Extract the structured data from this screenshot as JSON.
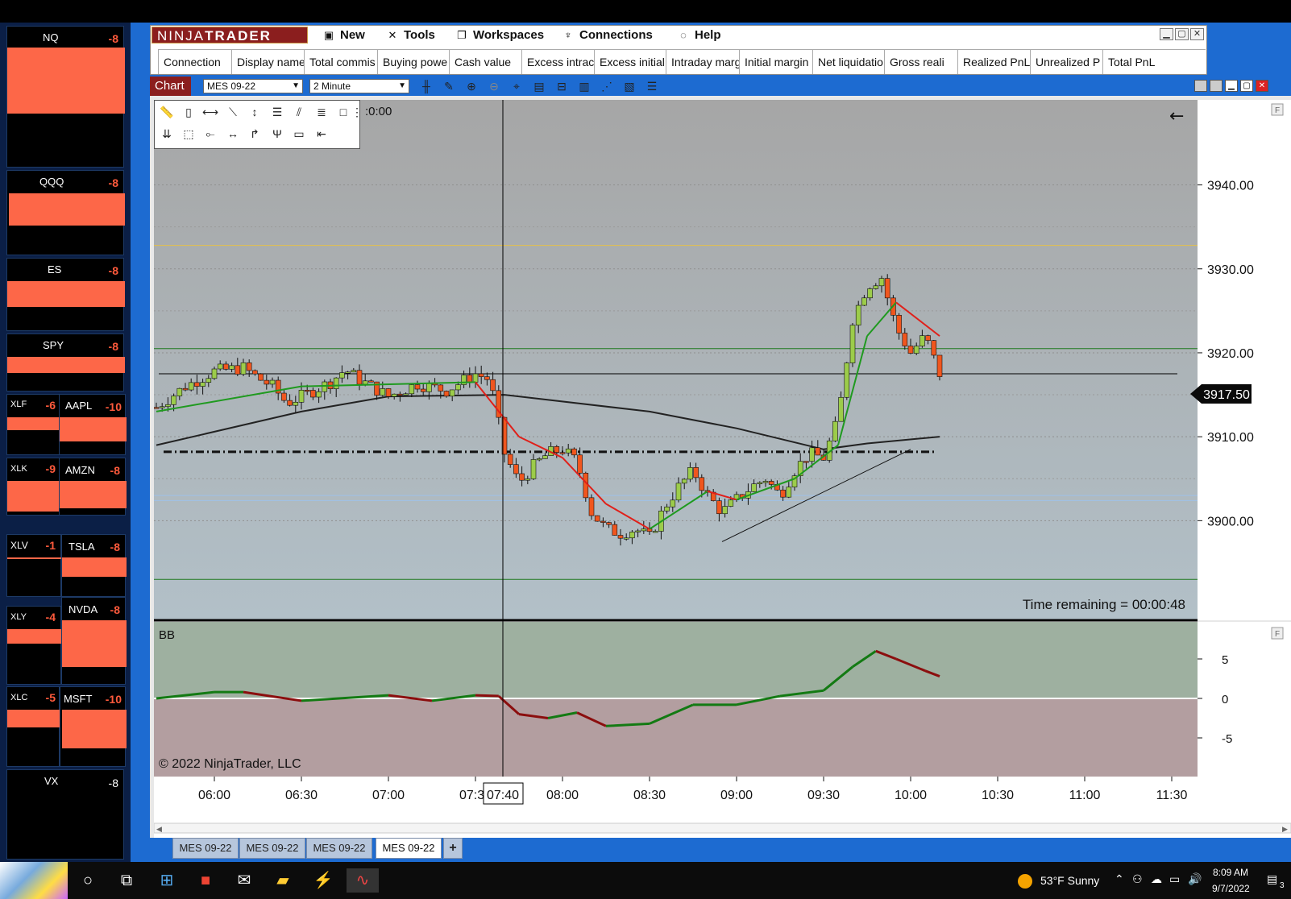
{
  "sidebar": {
    "tiles": [
      {
        "symbol": "NQ",
        "value": "-8"
      },
      {
        "symbol": "QQQ",
        "value": "-8"
      },
      {
        "symbol": "ES",
        "value": "-8"
      },
      {
        "symbol": "SPY",
        "value": "-8"
      },
      {
        "symbol": "XLF",
        "value": "-6"
      },
      {
        "symbol": "AAPL",
        "value": "-10"
      },
      {
        "symbol": "XLK",
        "value": "-9"
      },
      {
        "symbol": "AMZN",
        "value": "-8"
      },
      {
        "symbol": "XLV",
        "value": "-1"
      },
      {
        "symbol": "TSLA",
        "value": "-8"
      },
      {
        "symbol": "XLY",
        "value": "-4"
      },
      {
        "symbol": "NVDA",
        "value": "-8"
      },
      {
        "symbol": "XLC",
        "value": "-5"
      },
      {
        "symbol": "MSFT",
        "value": "-10"
      },
      {
        "symbol": "VX",
        "value": "-8"
      }
    ]
  },
  "control_center": {
    "logo_left": "NINJA",
    "logo_right": "TRADER",
    "menu": [
      "New",
      "Tools",
      "Workspaces",
      "Connections",
      "Help"
    ],
    "columns": [
      "Connection",
      "Display name",
      "Total commis",
      "Buying powe",
      "Cash value",
      "Excess intrac",
      "Excess initial",
      "Intraday marg",
      "Initial margin",
      "Net liquidatio",
      "Gross reali",
      "Realized PnL",
      "Unrealized P",
      "Total PnL"
    ]
  },
  "chart_window": {
    "tag": "Chart",
    "instrument": "MES 09-22",
    "interval": "2 Minute",
    "time_partial": ":0:00",
    "time_remaining": "Time remaining = 00:00:48",
    "copyright": "© 2022 NinjaTrader, LLC",
    "indicator_label": "BB",
    "crosshair_label": "07:40",
    "price_marker": "3917.50",
    "tabs": [
      "MES 09-22",
      "MES 09-22",
      "MES 09-22",
      "MES 09-22"
    ]
  },
  "taskbar": {
    "weather": "53°F  Sunny",
    "time": "8:09 AM",
    "date": "9/7/2022",
    "notif_count": "3"
  },
  "chart_data": [
    {
      "type": "candlestick",
      "instrument": "MES 09-22",
      "interval": "2 Minute",
      "y_ticks": [
        3900,
        3910,
        3920,
        3930,
        3940
      ],
      "y_tick_labels": [
        "3900.00",
        "3910.00",
        "3920.00",
        "3930.00",
        "3940.00"
      ],
      "ylim": [
        3890,
        3952
      ],
      "x_tick_labels": [
        "06:00",
        "06:30",
        "07:00",
        "07:30",
        "08:00",
        "08:30",
        "09:00",
        "09:30",
        "10:00",
        "10:30",
        "11:00",
        "11:30"
      ],
      "last_price": 3917.5,
      "horizontal_lines": [
        {
          "price": 3932.8,
          "color": "#e6c14a"
        },
        {
          "price": 3920.5,
          "color": "#1f7a1f"
        },
        {
          "price": 3917.5,
          "color": "#000000"
        },
        {
          "price": 3908.2,
          "color": "#111111",
          "style": "dash-dot"
        },
        {
          "price": 3903.0,
          "color": "#9fc1e8"
        },
        {
          "price": 3902.4,
          "color": "#9fc1e8"
        },
        {
          "price": 3893.0,
          "color": "#1f7a1f"
        }
      ],
      "close_path": [
        {
          "t": "05:40",
          "c": 3913.5
        },
        {
          "t": "05:50",
          "c": 3916.0
        },
        {
          "t": "06:00",
          "c": 3917.8
        },
        {
          "t": "06:10",
          "c": 3918.2
        },
        {
          "t": "06:15",
          "c": 3917.0
        },
        {
          "t": "06:20",
          "c": 3916.0
        },
        {
          "t": "06:25",
          "c": 3914.0
        },
        {
          "t": "06:30",
          "c": 3914.8
        },
        {
          "t": "06:40",
          "c": 3916.5
        },
        {
          "t": "06:45",
          "c": 3918.0
        },
        {
          "t": "06:50",
          "c": 3916.8
        },
        {
          "t": "07:00",
          "c": 3914.8
        },
        {
          "t": "07:10",
          "c": 3916.3
        },
        {
          "t": "07:20",
          "c": 3915.5
        },
        {
          "t": "07:30",
          "c": 3917.5
        },
        {
          "t": "07:35",
          "c": 3916.8
        },
        {
          "t": "07:40",
          "c": 3908.0
        },
        {
          "t": "07:45",
          "c": 3904.5
        },
        {
          "t": "07:50",
          "c": 3906.5
        },
        {
          "t": "07:55",
          "c": 3908.0
        },
        {
          "t": "08:00",
          "c": 3908.5
        },
        {
          "t": "08:05",
          "c": 3907.0
        },
        {
          "t": "08:10",
          "c": 3901.0
        },
        {
          "t": "08:15",
          "c": 3899.0
        },
        {
          "t": "08:20",
          "c": 3898.5
        },
        {
          "t": "08:25",
          "c": 3899.0
        },
        {
          "t": "08:30",
          "c": 3898.0
        },
        {
          "t": "08:35",
          "c": 3901.5
        },
        {
          "t": "08:40",
          "c": 3904.0
        },
        {
          "t": "08:45",
          "c": 3906.0
        },
        {
          "t": "08:50",
          "c": 3903.0
        },
        {
          "t": "08:55",
          "c": 3901.0
        },
        {
          "t": "09:00",
          "c": 3902.5
        },
        {
          "t": "09:05",
          "c": 3904.0
        },
        {
          "t": "09:10",
          "c": 3905.0
        },
        {
          "t": "09:15",
          "c": 3903.0
        },
        {
          "t": "09:20",
          "c": 3906.0
        },
        {
          "t": "09:25",
          "c": 3908.0
        },
        {
          "t": "09:30",
          "c": 3907.5
        },
        {
          "t": "09:35",
          "c": 3912.0
        },
        {
          "t": "09:40",
          "c": 3924.0
        },
        {
          "t": "09:45",
          "c": 3928.0
        },
        {
          "t": "09:50",
          "c": 3929.0
        },
        {
          "t": "09:55",
          "c": 3923.0
        },
        {
          "t": "10:00",
          "c": 3920.0
        },
        {
          "t": "10:05",
          "c": 3922.0
        },
        {
          "t": "10:10",
          "c": 3917.5
        }
      ],
      "ema_fast_path": [
        {
          "t": "05:40",
          "c": 3913.0
        },
        {
          "t": "06:30",
          "c": 3916.0
        },
        {
          "t": "07:30",
          "c": 3916.5
        },
        {
          "t": "07:45",
          "c": 3910.0
        },
        {
          "t": "08:00",
          "c": 3907.5
        },
        {
          "t": "08:15",
          "c": 3902.0
        },
        {
          "t": "08:30",
          "c": 3899.0
        },
        {
          "t": "08:50",
          "c": 3903.5
        },
        {
          "t": "09:00",
          "c": 3902.5
        },
        {
          "t": "09:20",
          "c": 3905.0
        },
        {
          "t": "09:35",
          "c": 3909.0
        },
        {
          "t": "09:45",
          "c": 3922.0
        },
        {
          "t": "09:55",
          "c": 3926.0
        },
        {
          "t": "10:10",
          "c": 3922.0
        }
      ],
      "sma_slow_path": [
        {
          "t": "05:40",
          "c": 3909.0
        },
        {
          "t": "06:30",
          "c": 3913.0
        },
        {
          "t": "07:00",
          "c": 3914.8
        },
        {
          "t": "07:40",
          "c": 3915.0
        },
        {
          "t": "08:30",
          "c": 3913.0
        },
        {
          "t": "09:00",
          "c": 3911.0
        },
        {
          "t": "09:30",
          "c": 3908.5
        },
        {
          "t": "09:45",
          "c": 3909.2
        },
        {
          "t": "10:10",
          "c": 3910.0
        }
      ],
      "trendline": [
        {
          "t": "08:55",
          "c": 3897.5
        },
        {
          "t": "10:00",
          "c": 3908.5
        }
      ]
    },
    {
      "type": "line",
      "title": "BB",
      "y_ticks": [
        -5,
        0,
        5
      ],
      "ylim": [
        -10,
        10
      ],
      "series": [
        {
          "values": [
            {
              "t": "05:40",
              "v": 0.0
            },
            {
              "t": "06:00",
              "v": 0.8
            },
            {
              "t": "06:10",
              "v": 0.8
            },
            {
              "t": "06:30",
              "v": -0.3
            },
            {
              "t": "07:00",
              "v": 0.4
            },
            {
              "t": "07:15",
              "v": -0.3
            },
            {
              "t": "07:30",
              "v": 0.4
            },
            {
              "t": "07:38",
              "v": 0.3
            },
            {
              "t": "07:45",
              "v": -2.0
            },
            {
              "t": "07:55",
              "v": -2.5
            },
            {
              "t": "08:05",
              "v": -1.8
            },
            {
              "t": "08:15",
              "v": -3.5
            },
            {
              "t": "08:30",
              "v": -3.2
            },
            {
              "t": "08:45",
              "v": -0.8
            },
            {
              "t": "09:00",
              "v": -0.8
            },
            {
              "t": "09:15",
              "v": 0.3
            },
            {
              "t": "09:30",
              "v": 1.0
            },
            {
              "t": "09:40",
              "v": 4.0
            },
            {
              "t": "09:48",
              "v": 6.0
            },
            {
              "t": "09:55",
              "v": 5.0
            },
            {
              "t": "10:05",
              "v": 3.5
            },
            {
              "t": "10:10",
              "v": 2.8
            }
          ]
        }
      ]
    }
  ]
}
